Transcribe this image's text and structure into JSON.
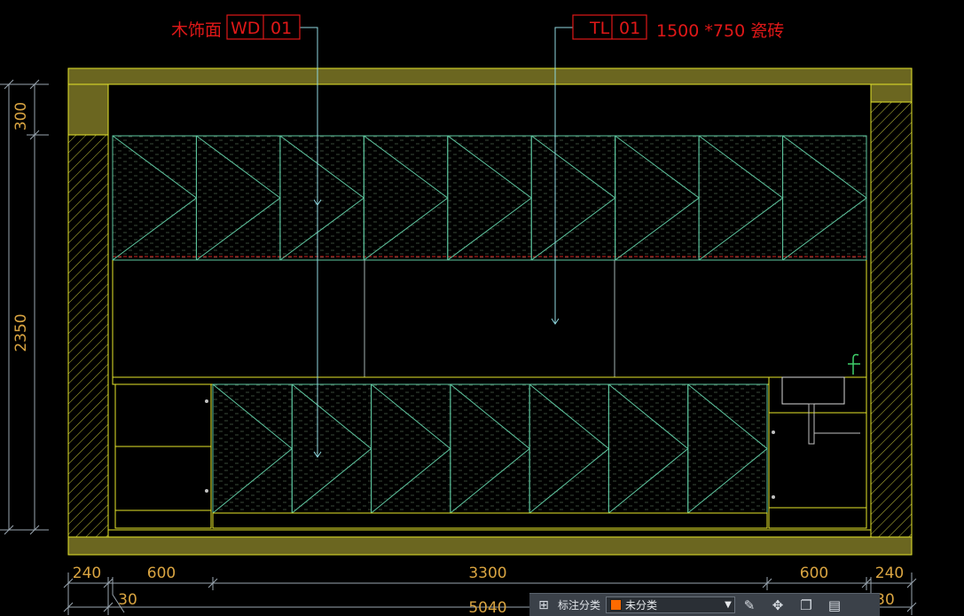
{
  "annotations": {
    "wood": {
      "desc": "木饰面",
      "code": "WD",
      "num": "01"
    },
    "tile": {
      "code": "TL",
      "num": "01",
      "desc": "1500 *750 瓷砖"
    }
  },
  "dimensions": {
    "left_vertical": [
      "300",
      "2350"
    ],
    "bottom_row1": [
      "240",
      "600",
      "3300",
      "600",
      "240"
    ],
    "bottom_row2": [
      "30",
      "5040",
      "30"
    ]
  },
  "toolbar": {
    "label": "标注分类",
    "select_value": "未分类",
    "select_color": "#ff6a00",
    "icons": [
      "grid-icon",
      "edit-icon",
      "move-icon",
      "copy-icon",
      "paste-icon"
    ]
  },
  "colors": {
    "background": "#000000",
    "outline": "#e6e62a",
    "wall_fill": "#6b6620",
    "leader": "#8fd8e0",
    "cabinet_lines": "#6fd0a8",
    "tag_red": "#e01818",
    "dimension": "#d9a441"
  }
}
